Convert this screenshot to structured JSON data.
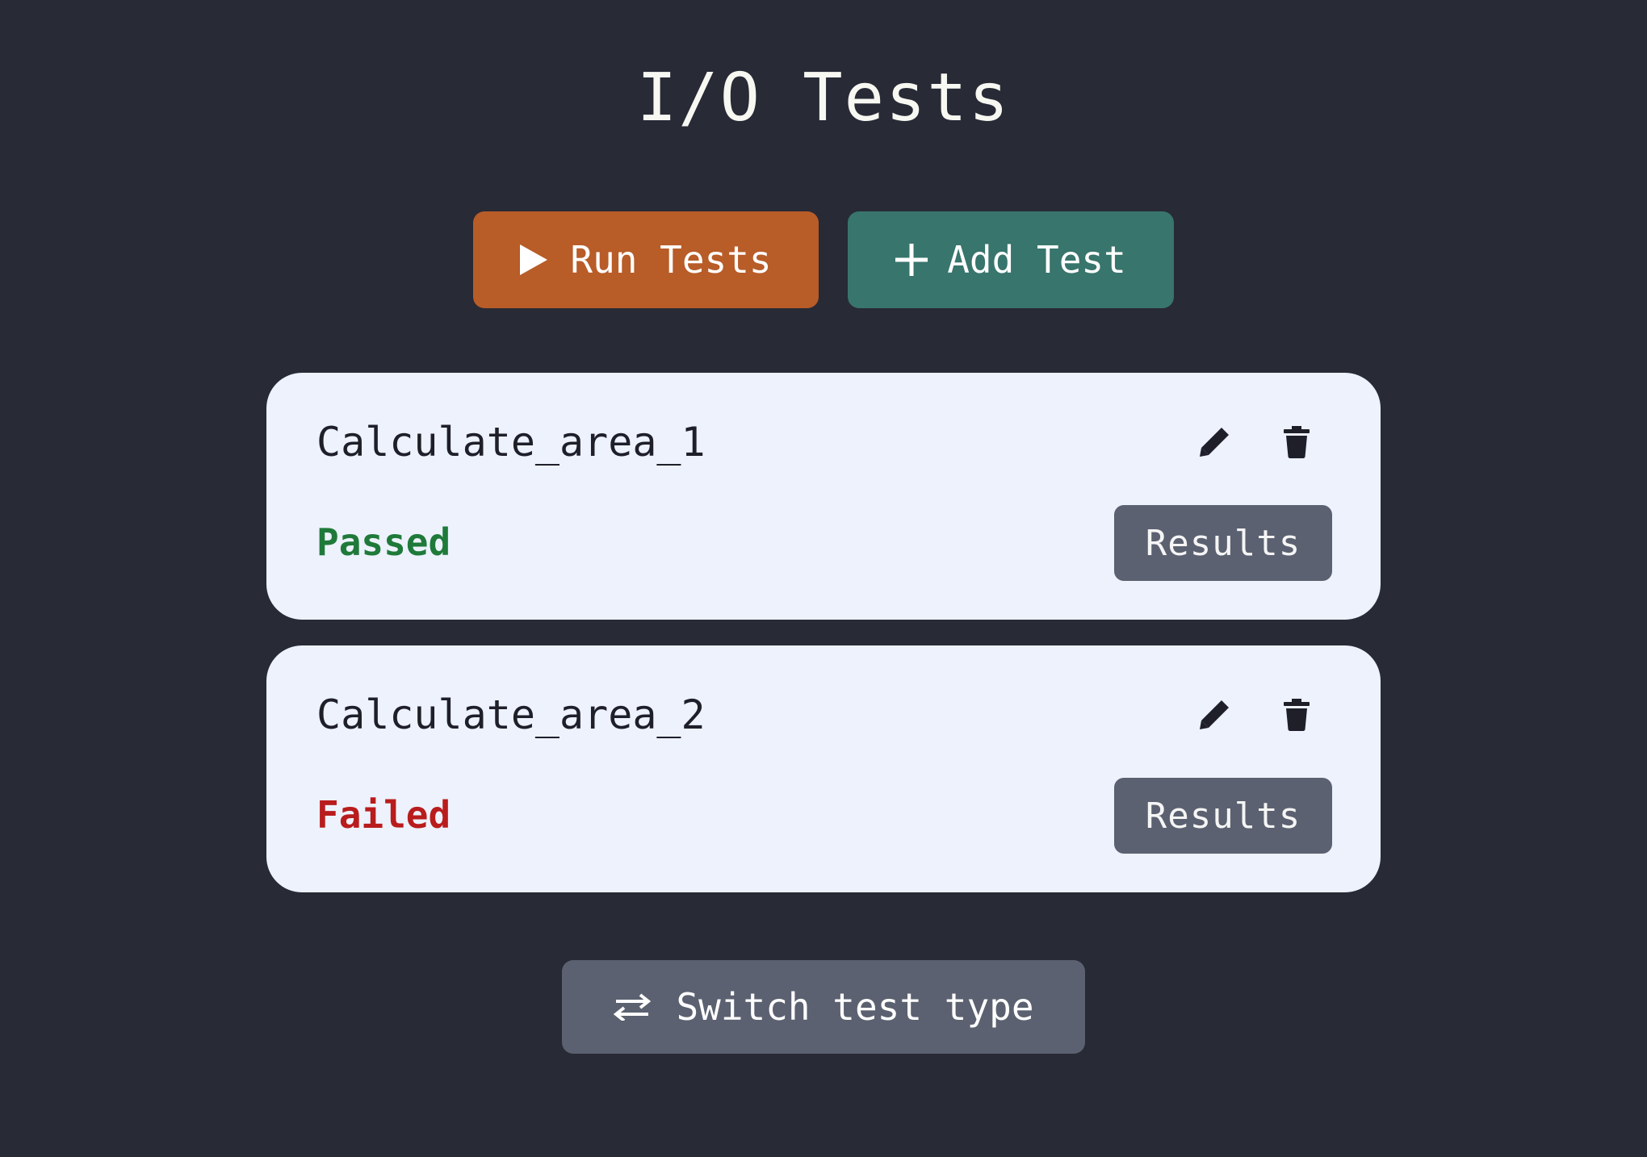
{
  "page": {
    "title": "I/O Tests"
  },
  "toolbar": {
    "run_label": "Run Tests",
    "add_label": "Add Test",
    "run_icon": "play-icon",
    "add_icon": "plus-icon"
  },
  "tests": [
    {
      "name": "Calculate_area_1",
      "status": "Passed",
      "results_label": "Results"
    },
    {
      "name": "Calculate_area_2",
      "status": "Failed",
      "results_label": "Results"
    }
  ],
  "footer": {
    "switch_label": "Switch test type",
    "switch_icon": "swap-arrows-icon"
  },
  "colors": {
    "background": "#282a36",
    "run_button": "#b85c28",
    "add_button": "#38756c",
    "card": "#edf2fd",
    "passed": "#1f7a3a",
    "failed": "#b91c1c",
    "neutral_button": "#5b6170"
  }
}
